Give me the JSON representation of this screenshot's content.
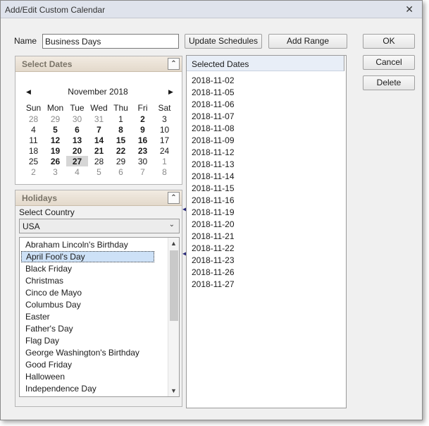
{
  "window": {
    "title": "Add/Edit Custom Calendar",
    "close_glyph": "✕"
  },
  "name_field": {
    "label": "Name",
    "value": "Business Days"
  },
  "buttons": {
    "update_schedules": "Update Schedules",
    "add_range": "Add Range",
    "ok": "OK",
    "cancel": "Cancel",
    "delete": "Delete"
  },
  "select_dates": {
    "header": "Select Dates",
    "collapse_glyph": "⌃",
    "month_label": "November 2018",
    "prev_glyph": "◀",
    "next_glyph": "▶",
    "weekdays": [
      "Sun",
      "Mon",
      "Tue",
      "Wed",
      "Thu",
      "Fri",
      "Sat"
    ],
    "weeks": [
      [
        "28",
        "29",
        "30",
        "31",
        "1",
        "2",
        "3"
      ],
      [
        "4",
        "5",
        "6",
        "7",
        "8",
        "9",
        "10"
      ],
      [
        "11",
        "12",
        "13",
        "14",
        "15",
        "16",
        "17"
      ],
      [
        "18",
        "19",
        "20",
        "21",
        "22",
        "23",
        "24"
      ],
      [
        "25",
        "26",
        "27",
        "28",
        "29",
        "30",
        "1"
      ],
      [
        "2",
        "3",
        "4",
        "5",
        "6",
        "7",
        "8"
      ]
    ],
    "today": "27"
  },
  "holidays": {
    "header": "Holidays",
    "collapse_glyph": "⌃",
    "country_label": "Select Country",
    "country_value": "USA",
    "dropdown_glyph": "⌄",
    "items": [
      "Abraham Lincoln's Birthday",
      "April Fool's Day",
      "Black Friday",
      "Christmas",
      "Cinco de Mayo",
      "Columbus Day",
      "Easter",
      "Father's Day",
      "Flag Day",
      "George Washington's Birthday",
      "Good Friday",
      "Halloween",
      "Independence Day"
    ],
    "selected_index": 1,
    "scroll_up_glyph": "▲",
    "scroll_down_glyph": "▼"
  },
  "selected_dates": {
    "header": "Selected Dates",
    "items": [
      "2018-11-02",
      "2018-11-05",
      "2018-11-06",
      "2018-11-07",
      "2018-11-08",
      "2018-11-09",
      "2018-11-12",
      "2018-11-13",
      "2018-11-14",
      "2018-11-15",
      "2018-11-16",
      "2018-11-19",
      "2018-11-20",
      "2018-11-21",
      "2018-11-22",
      "2018-11-23",
      "2018-11-26",
      "2018-11-27"
    ]
  },
  "splitter": {
    "up_glyph": "◀",
    "down_glyph": "◀"
  }
}
